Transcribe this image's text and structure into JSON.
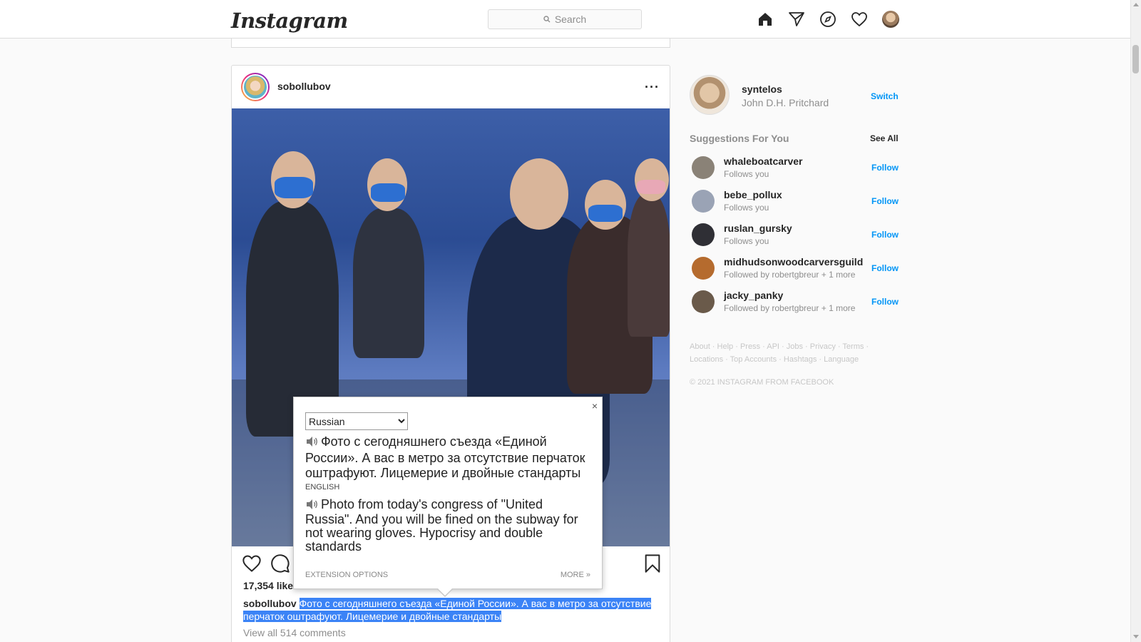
{
  "header": {
    "logo": "Instagram",
    "search_placeholder": "Search"
  },
  "post": {
    "username": "sobollubov",
    "likes": "17,354 like",
    "caption_user": "sobollubov",
    "caption_text": "Фото с сегодняшнего съезда «Единой России». А вас в метро за отсутствие перчаток оштрафуют. Лицемерие и двойные стандарты",
    "view_comments": "View all 514 comments"
  },
  "popup": {
    "close": "×",
    "language_selected": "Russian",
    "source_text": "Фото с сегодняшнего съезда «Единой России». А вас в метро за отсутствие перчаток оштрафуют. Лицемерие и двойные стандарты",
    "target_lang": "ENGLISH",
    "translated_text": "Photo from today's congress of \"United Russia\". And you will be fined on the subway for not wearing gloves. Hypocrisy and double standards",
    "extension_options": "EXTENSION OPTIONS",
    "more": "MORE »"
  },
  "sidebar": {
    "me": {
      "username": "syntelos",
      "full_name": "John D.H. Pritchard",
      "switch": "Switch"
    },
    "suggestions_title": "Suggestions For You",
    "see_all": "See All",
    "suggestions": [
      {
        "username": "whaleboatcarver",
        "sub": "Follows you",
        "action": "Follow",
        "color": "#8a8277"
      },
      {
        "username": "bebe_pollux",
        "sub": "Follows you",
        "action": "Follow",
        "color": "#9aa3b5"
      },
      {
        "username": "ruslan_gursky",
        "sub": "Follows you",
        "action": "Follow",
        "color": "#2f2f35"
      },
      {
        "username": "midhudsonwoodcarversguild",
        "sub": "Followed by robertgbreur + 1 more",
        "action": "Follow",
        "color": "#b56b2e"
      },
      {
        "username": "jacky_panky",
        "sub": "Followed by robertgbreur + 1 more",
        "action": "Follow",
        "color": "#6a5a4a"
      }
    ],
    "footer_links_row1": [
      "About",
      "Help",
      "Press",
      "API",
      "Jobs",
      "Privacy",
      "Terms"
    ],
    "footer_links_row2": [
      "Locations",
      "Top Accounts",
      "Hashtags",
      "Language"
    ],
    "copyright": "© 2021 INSTAGRAM FROM FACEBOOK"
  },
  "colors": {
    "link_blue": "#0095f6",
    "selection_blue": "#3b83f6",
    "border": "#dbdbdb"
  }
}
